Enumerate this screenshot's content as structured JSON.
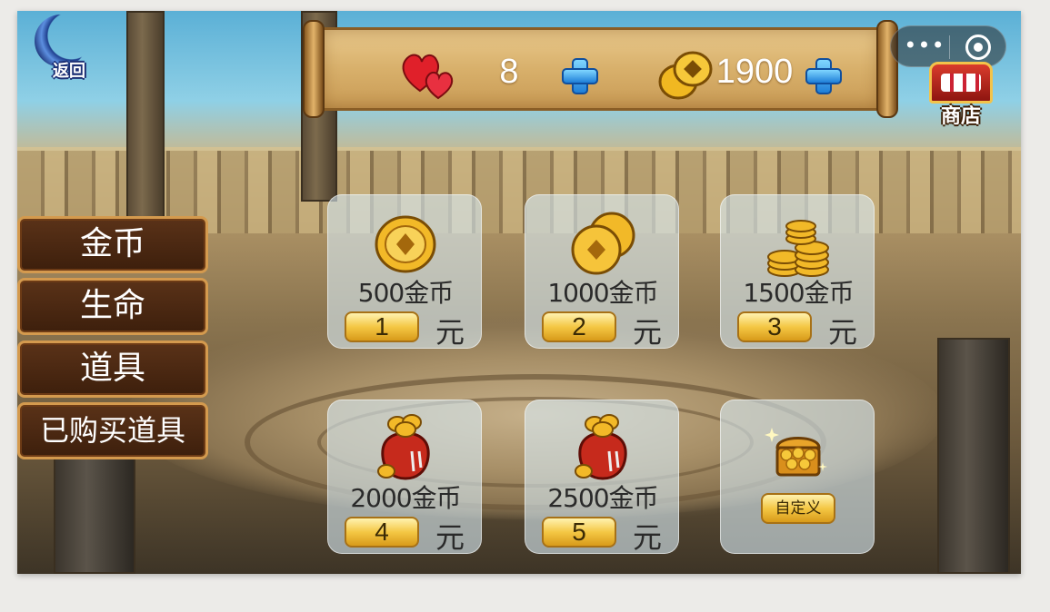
{
  "nav": {
    "back_label": "返回",
    "shop_label": "商店"
  },
  "header": {
    "lives": "8",
    "coins": "1900"
  },
  "capsule": {
    "more_label": "•••"
  },
  "menu": [
    {
      "label": "金币"
    },
    {
      "label": "生命"
    },
    {
      "label": "道具"
    },
    {
      "label": "已购买道具"
    }
  ],
  "cards": [
    {
      "amount": "500金币",
      "price": "1",
      "unit": "元",
      "icon": "single-coin-icon"
    },
    {
      "amount": "1000金币",
      "price": "2",
      "unit": "元",
      "icon": "coin-pair-icon"
    },
    {
      "amount": "1500金币",
      "price": "3",
      "unit": "元",
      "icon": "coin-stack-icon"
    },
    {
      "amount": "2000金币",
      "price": "4",
      "unit": "元",
      "icon": "coin-bag-icon"
    },
    {
      "amount": "2500金币",
      "price": "5",
      "unit": "元",
      "icon": "coin-bag-icon"
    },
    {
      "custom_label": "自定义",
      "icon": "treasure-chest-icon"
    }
  ],
  "colors": {
    "menu_bg": "#4a2812",
    "menu_border": "#d49a4e",
    "card_bg": "#d6e8f0",
    "price_gold": "#f4c744",
    "plus_blue": "#1f7fd8"
  }
}
